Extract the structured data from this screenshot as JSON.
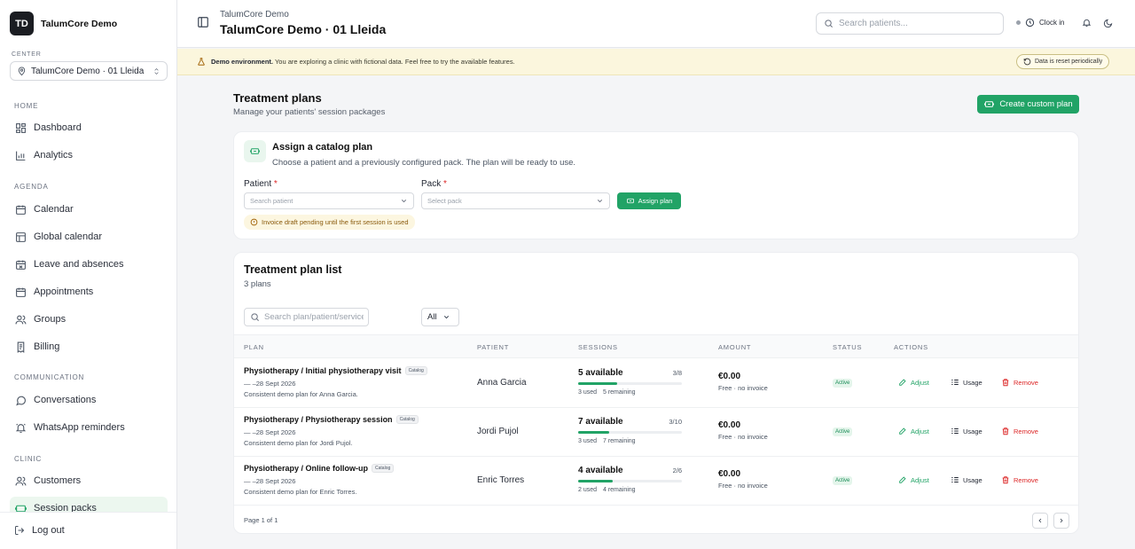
{
  "sidebar": {
    "brand_initials": "TD",
    "brand_name": "TalumCore Demo",
    "center_label": "CENTER",
    "center_value": "TalumCore Demo · 01 Lleida",
    "sections": {
      "home": "HOME",
      "agenda": "AGENDA",
      "communication": "COMMUNICATION",
      "clinic": "CLINIC"
    },
    "items": {
      "dashboard": "Dashboard",
      "analytics": "Analytics",
      "calendar": "Calendar",
      "global_calendar": "Global calendar",
      "leave": "Leave and absences",
      "appointments": "Appointments",
      "groups": "Groups",
      "billing": "Billing",
      "conversations": "Conversations",
      "whatsapp": "WhatsApp reminders",
      "customers": "Customers",
      "session_packs": "Session packs"
    },
    "logout": "Log out"
  },
  "topbar": {
    "breadcrumb": "TalumCore Demo",
    "title": "TalumCore Demo · 01 Lleida",
    "search_placeholder": "Search patients...",
    "clock_in": "Clock in"
  },
  "banner": {
    "strong": "Demo environment.",
    "text": " You are exploring a clinic with fictional data. Feel free to try the available features.",
    "pill": "Data is reset periodically"
  },
  "main": {
    "title": "Treatment plans",
    "subtitle": "Manage your patients' session packages",
    "create_button": "Create custom plan"
  },
  "assign": {
    "title": "Assign a catalog plan",
    "subtitle": "Choose a patient and a previously configured pack. The plan will be ready to use.",
    "patient_label": "Patient",
    "patient_placeholder": "Search patient",
    "pack_label": "Pack",
    "pack_placeholder": "Select pack",
    "required_mark": "*",
    "button": "Assign plan",
    "warning": "Invoice draft pending until the first session is used"
  },
  "list": {
    "title": "Treatment plan list",
    "count": "3 plans",
    "search_placeholder": "Search plan/patient/service",
    "filter_value": "All",
    "columns": [
      "PLAN",
      "PATIENT",
      "SESSIONS",
      "AMOUNT",
      "STATUS",
      "ACTIONS"
    ],
    "rows": [
      {
        "plan": "Physiotherapy / Initial physiotherapy visit",
        "badge": "Catalog",
        "dates": "— –28 Sept 2026",
        "description": "Consistent demo plan for Anna Garcia.",
        "patient": "Anna Garcia",
        "available": "5 available",
        "ratio": "3/8",
        "progress": 0.375,
        "used": "3 used",
        "remaining": "5 remaining",
        "amount": "€0.00",
        "amount_note": "Free · no invoice",
        "status": "Active",
        "adjust": "Adjust",
        "usage": "Usage",
        "remove": "Remove"
      },
      {
        "plan": "Physiotherapy / Physiotherapy session",
        "badge": "Catalog",
        "dates": "— –28 Sept 2026",
        "description": "Consistent demo plan for Jordi Pujol.",
        "patient": "Jordi Pujol",
        "available": "7 available",
        "ratio": "3/10",
        "progress": 0.3,
        "used": "3 used",
        "remaining": "7 remaining",
        "amount": "€0.00",
        "amount_note": "Free · no invoice",
        "status": "Active",
        "adjust": "Adjust",
        "usage": "Usage",
        "remove": "Remove"
      },
      {
        "plan": "Physiotherapy / Online follow-up",
        "badge": "Catalog",
        "dates": "— –28 Sept 2026",
        "description": "Consistent demo plan for Enric Torres.",
        "patient": "Enric Torres",
        "available": "4 available",
        "ratio": "2/6",
        "progress": 0.333,
        "used": "2 used",
        "remaining": "4 remaining",
        "amount": "€0.00",
        "amount_note": "Free · no invoice",
        "status": "Active",
        "adjust": "Adjust",
        "usage": "Usage",
        "remove": "Remove"
      }
    ],
    "pagination": "Page 1 of 1"
  },
  "colors": {
    "accent": "#21a366",
    "danger": "#dc2626",
    "banner_bg": "#fbf6dd"
  },
  "icons": [
    "search-icon",
    "clock-icon",
    "bell-icon",
    "moon-icon",
    "sidebar-toggle-icon",
    "flask-icon",
    "reset-icon",
    "ticket-icon",
    "chevron-down-icon",
    "alert-circle-icon",
    "pencil-icon",
    "list-icon",
    "trash-icon",
    "chevron-left-icon",
    "chevron-right-icon"
  ]
}
